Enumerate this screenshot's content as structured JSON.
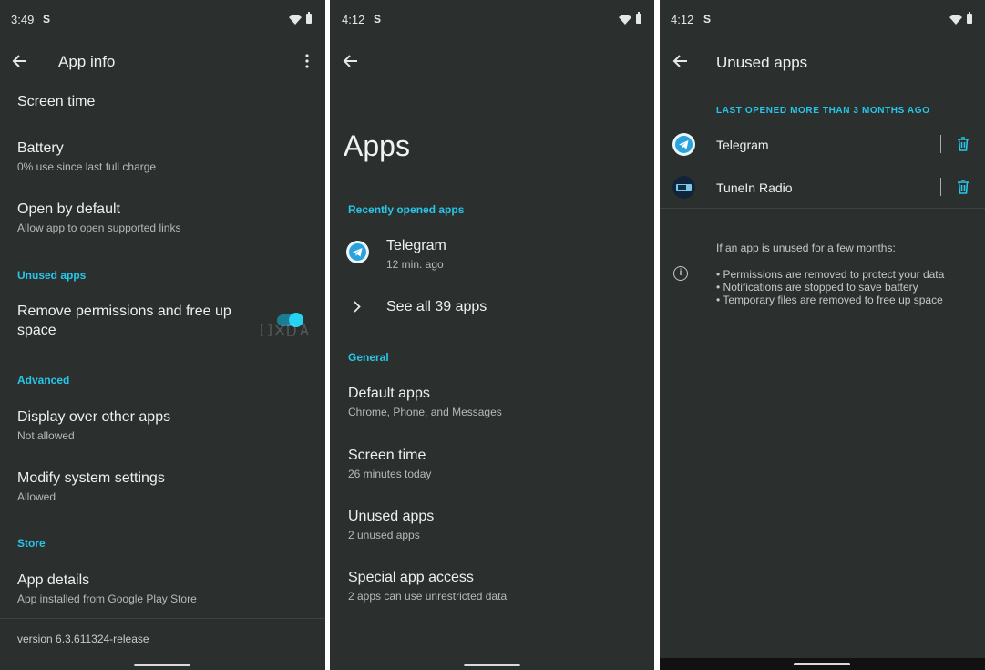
{
  "panel1": {
    "status_time": "3:49",
    "title": "App info",
    "rows": [
      {
        "title": "Screen time"
      },
      {
        "title": "Battery",
        "subtitle": "0% use since last full charge"
      },
      {
        "title": "Open by default",
        "subtitle": "Allow app to open supported links"
      }
    ],
    "section_unused": "Unused apps",
    "remove_perm_line1": "Remove permissions and free up",
    "remove_perm_line2": "space",
    "remove_perm_toggle_on": true,
    "section_advanced": "Advanced",
    "display_over_title": "Display over other apps",
    "display_over_sub": "Not allowed",
    "modify_title": "Modify system settings",
    "modify_sub": "Allowed",
    "section_store": "Store",
    "app_details_title": "App details",
    "app_details_sub": "App installed from Google Play Store",
    "version": "version 6.3.611324-release"
  },
  "panel2": {
    "status_time": "4:12",
    "big_title": "Apps",
    "section_recent": "Recently opened apps",
    "recent_app_name": "Telegram",
    "recent_app_time": "12 min. ago",
    "see_all": "See all 39 apps",
    "section_general": "General",
    "default_apps_title": "Default apps",
    "default_apps_sub": "Chrome, Phone, and Messages",
    "screen_time_title": "Screen time",
    "screen_time_sub": "26 minutes today",
    "unused_title": "Unused apps",
    "unused_sub": "2 unused apps",
    "special_title": "Special app access",
    "special_sub": "2 apps can use unrestricted data"
  },
  "panel3": {
    "status_time": "4:12",
    "title": "Unused apps",
    "section": "LAST OPENED MORE THAN 3 MONTHS AGO",
    "apps": [
      {
        "name": "Telegram"
      },
      {
        "name": "TuneIn Radio"
      }
    ],
    "info_heading": "If an app is unused for a few months:",
    "info_lines": [
      "• Permissions are removed to protect your data",
      "• Notifications are stopped to save battery",
      "• Temporary files are removed to free up space"
    ]
  },
  "icons": {
    "status_s": "S",
    "info_glyph": "i"
  },
  "colors": {
    "background": "#2b302f",
    "accent": "#27c6e8"
  }
}
